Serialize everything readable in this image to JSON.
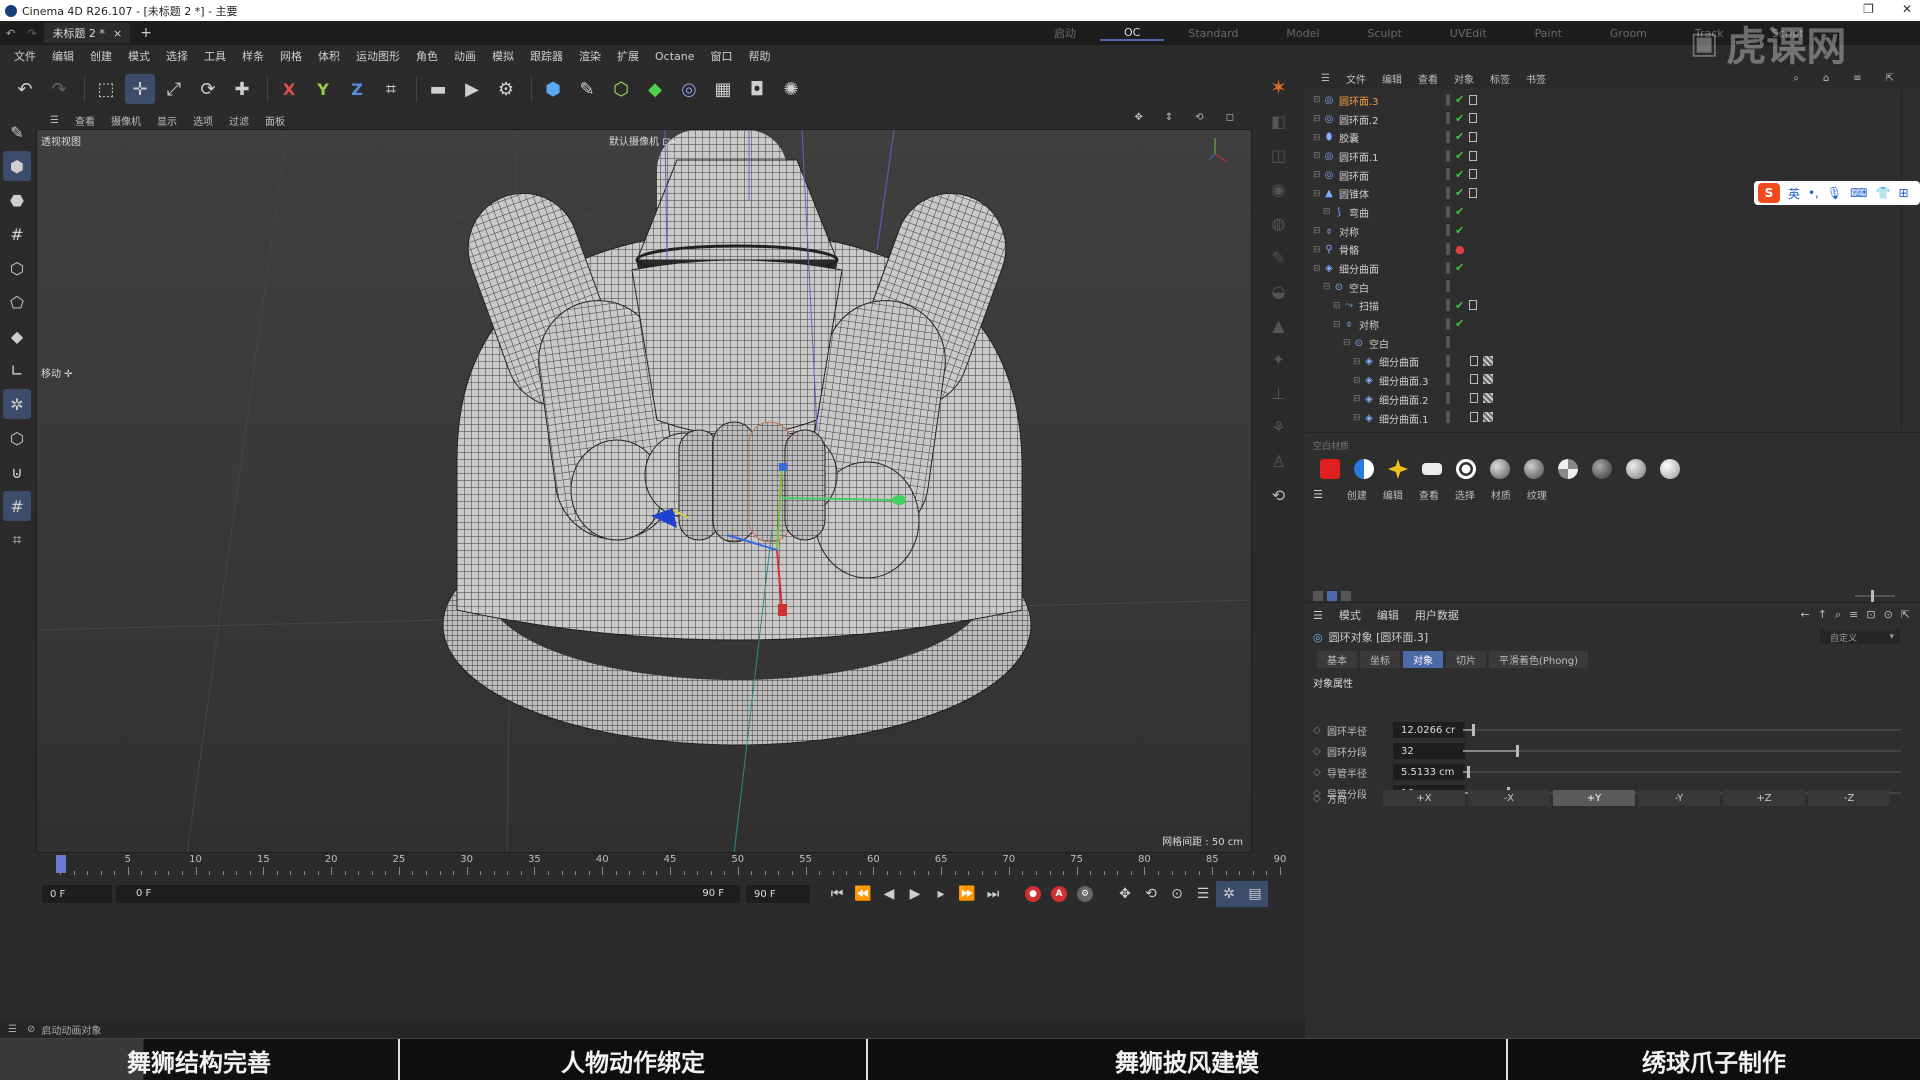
{
  "window": {
    "title": "Cinema 4D R26.107 - [未标题 2 *] - 主要"
  },
  "doc_tab": {
    "label": "未标题 2 *"
  },
  "layouts": [
    "启动",
    "OC",
    "Standard",
    "Model",
    "Sculpt",
    "UVEdit",
    "Paint",
    "Groom",
    "Track",
    "Script"
  ],
  "menu": [
    "文件",
    "编辑",
    "创建",
    "模式",
    "选择",
    "工具",
    "样条",
    "网格",
    "体积",
    "运动图形",
    "角色",
    "动画",
    "模拟",
    "跟踪器",
    "渲染",
    "扩展",
    "Octane",
    "窗口",
    "帮助"
  ],
  "viewport": {
    "menu": [
      "查看",
      "摄像机",
      "显示",
      "选项",
      "过滤",
      "面板"
    ],
    "name": "透视视图",
    "camera": "默认摄像机 ⊡•",
    "grid_info": "网格间距 : 50 cm",
    "tool_label": "移动 ✛"
  },
  "timeline": {
    "ticks": [
      "0",
      "5",
      "10",
      "15",
      "20",
      "25",
      "30",
      "35",
      "40",
      "45",
      "50",
      "55",
      "60",
      "65",
      "70",
      "75",
      "80",
      "85",
      "90"
    ],
    "cur_frame": "0 F",
    "start": "0 F",
    "end_inner": "90 F",
    "end": "90 F"
  },
  "statusbar": {
    "text": "启动动画对象"
  },
  "bottom_tabs": [
    "舞狮结构完善",
    "人物动作绑定",
    "舞狮披风建模",
    "绣球爪子制作"
  ],
  "object_manager": {
    "menu": [
      "文件",
      "编辑",
      "查看",
      "对象",
      "标签",
      "书签"
    ],
    "objects": [
      {
        "name": "圆环面.3",
        "icon": "torus",
        "indent": 0,
        "selected": true,
        "check": "green",
        "flag": true
      },
      {
        "name": "圆环面.2",
        "icon": "torus",
        "indent": 0,
        "selected": false,
        "check": "green",
        "flag": true
      },
      {
        "name": "胶囊",
        "icon": "capsule",
        "indent": 0,
        "selected": false,
        "check": "green",
        "flag": true
      },
      {
        "name": "圆环面.1",
        "icon": "torus",
        "indent": 0,
        "selected": false,
        "check": "green",
        "flag": true
      },
      {
        "name": "圆环面",
        "icon": "torus",
        "indent": 0,
        "selected": false,
        "check": "green",
        "flag": true
      },
      {
        "name": "圆锥体",
        "icon": "cone",
        "indent": 0,
        "selected": false,
        "check": "green",
        "flag": true
      },
      {
        "name": "弯曲",
        "icon": "bend",
        "indent": 1,
        "selected": false,
        "check": "green",
        "flag": false
      },
      {
        "name": "对称",
        "icon": "symmetry",
        "indent": 0,
        "selected": false,
        "check": "green",
        "flag": false
      },
      {
        "name": "骨骼",
        "icon": "bone",
        "indent": 0,
        "selected": false,
        "check": "red",
        "flag": false
      },
      {
        "name": "细分曲面",
        "icon": "subdiv",
        "indent": 0,
        "selected": false,
        "check": "green",
        "flag": false
      },
      {
        "name": "空白",
        "icon": "null",
        "indent": 1,
        "selected": false,
        "check": "none",
        "flag": false
      },
      {
        "name": "扫描",
        "icon": "sweep",
        "indent": 2,
        "selected": false,
        "check": "green",
        "flag": true
      },
      {
        "name": "对称",
        "icon": "symmetry",
        "indent": 2,
        "selected": false,
        "check": "green",
        "flag": false
      },
      {
        "name": "空白",
        "icon": "null",
        "indent": 3,
        "selected": false,
        "check": "none",
        "flag": false
      },
      {
        "name": "细分曲面",
        "icon": "subdiv",
        "indent": 4,
        "selected": false,
        "check": "none",
        "flag": true
      },
      {
        "name": "细分曲面.3",
        "icon": "subdiv",
        "indent": 4,
        "selected": false,
        "check": "none",
        "flag": true
      },
      {
        "name": "细分曲面.2",
        "icon": "subdiv",
        "indent": 4,
        "selected": false,
        "check": "none",
        "flag": true
      },
      {
        "name": "细分曲面.1",
        "icon": "subdiv",
        "indent": 4,
        "selected": false,
        "check": "none",
        "flag": true
      }
    ]
  },
  "ime": {
    "logo": "S",
    "lang": "英"
  },
  "material_manager": {
    "label": "空白材质",
    "menu": [
      "创建",
      "编辑",
      "查看",
      "选择",
      "材质",
      "纹理"
    ]
  },
  "attributes": {
    "menu": [
      "模式",
      "编辑",
      "用户数据"
    ],
    "object_title": "圆环对象 [圆环面.3]",
    "preset": "自定义",
    "tabs": [
      "基本",
      "坐标",
      "对象",
      "切片"
    ],
    "active_tab": "对象",
    "phong": "平滑着色(Phong)",
    "section": "对象属性",
    "rows": [
      {
        "label": "圆环半径",
        "value": "12.0266 cr",
        "fill": 0.02
      },
      {
        "label": "圆环分段",
        "value": "32",
        "fill": 0.12
      },
      {
        "label": "导管半径",
        "value": "5.5133 cm",
        "fill": 0.01
      },
      {
        "label": "导管分段",
        "value": "16",
        "fill": 0.1
      }
    ],
    "direction_label": "方向",
    "directions": [
      "+X",
      "-X",
      "+Y",
      "-Y",
      "+Z",
      "-Z"
    ],
    "active_direction": "+Y"
  },
  "colors": {
    "accent": "#4c6aa8",
    "selected_text": "#f0a040",
    "check_green": "#46c146"
  }
}
